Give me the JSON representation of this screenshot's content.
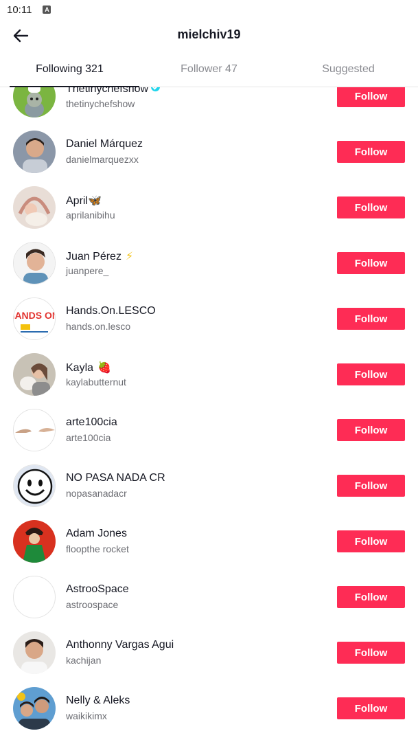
{
  "statusbar": {
    "time": "10:11",
    "notification_icon": "A"
  },
  "header": {
    "title": "mielchiv19",
    "back_icon": "arrow-left-icon"
  },
  "tabs": [
    {
      "label": "Following 321",
      "active": true
    },
    {
      "label": "Follower 47",
      "active": false
    },
    {
      "label": "Suggested",
      "active": false
    }
  ],
  "users": [
    {
      "name": "Thetinychefshow",
      "handle": "thetinychefshow",
      "button": "Follow",
      "verified": true
    },
    {
      "name": "Daniel Márquez",
      "handle": "danielmarquezxx",
      "button": "Follow"
    },
    {
      "name": "April🦋",
      "handle": "aprilanibihu",
      "button": "Follow"
    },
    {
      "name": "Juan Pérez",
      "emoji": "⚡",
      "handle": "juanpere_",
      "button": "Follow"
    },
    {
      "name": "Hands.On.LESCO",
      "handle": "hands.on.lesco",
      "button": "Follow",
      "avatar_text": "HANDS ON!"
    },
    {
      "name": "Kayla",
      "emoji": "🍓",
      "handle": "kaylabutternut",
      "button": "Follow"
    },
    {
      "name": "arte100cia",
      "handle": "arte100cia",
      "button": "Follow"
    },
    {
      "name": "NO PASA NADA CR",
      "handle": "nopasanadacr",
      "button": "Follow"
    },
    {
      "name": "Adam Jones",
      "handle": "floopthe rocket",
      "button": "Follow"
    },
    {
      "name": "AstrooSpace",
      "handle": "astroospace",
      "button": "Follow"
    },
    {
      "name": "Anthonny Vargas Agui",
      "handle": "kachijan",
      "button": "Follow"
    },
    {
      "name": "Nelly & Aleks",
      "handle": "waikikimx",
      "button": "Follow"
    }
  ],
  "colors": {
    "accent": "#fe2c55",
    "verified": "#20d5ec",
    "text_primary": "#161823",
    "text_secondary": "#6b6c72"
  }
}
